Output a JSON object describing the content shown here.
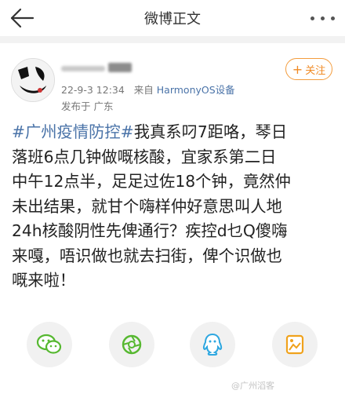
{
  "header": {
    "title": "微博正文",
    "back_icon": "back-arrow-icon",
    "more_icon": "more-dots-icon"
  },
  "post": {
    "date": "22-9-3 12:34",
    "source_prefix": "来自",
    "device": "HarmonyOS设备",
    "location_label": "发布于 广东",
    "follow_label": "关注",
    "follow_plus": "+",
    "topic": "#广州疫情防控#",
    "lines": [
      "我真系叼7距咯，琴日",
      "落班6点几钟做嘅核酸，宜家系第二日",
      "中午12点半，足足过佐18个钟，竟然仲",
      "未出结果，就甘个嗨样仲好意思叫人地",
      "24h核酸阴性先俾通行？疾控d乜Q傻嗨",
      "来嘎，唔识做也就去扫街，俾个识做也",
      "嘅来啦！"
    ]
  },
  "share_buttons": [
    "wechat-icon",
    "moments-icon",
    "qq-icon",
    "save-image-icon"
  ],
  "watermark": "@广州滔客",
  "colors": {
    "link": "#4a73a8",
    "follow": "#f08a24",
    "meta": "#777777"
  }
}
